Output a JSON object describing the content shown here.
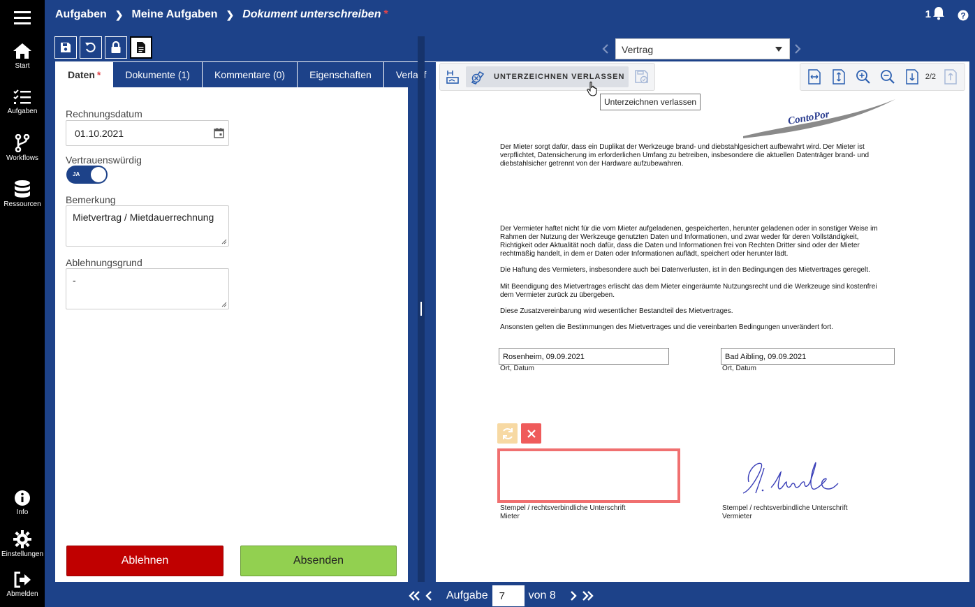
{
  "nav": {
    "home": "Start",
    "tasks": "Aufgaben",
    "workflows": "Workflows",
    "resources": "Ressourcen",
    "info": "Info",
    "settings": "Einstellungen",
    "logout": "Abmelden"
  },
  "header": {
    "crumb1": "Aufgaben",
    "crumb2": "Meine Aufgaben",
    "crumb3": "Dokument unterschreiben",
    "required_mark": "*",
    "notification_count": "1"
  },
  "tabs": {
    "data": "Daten",
    "data_required": "*",
    "documents": "Dokumente (1)",
    "comments": "Kommentare (0)",
    "properties": "Eigenschaften",
    "history": "Verlauf"
  },
  "form": {
    "invoice_date_label": "Rechnungsdatum",
    "invoice_date_value": "01.10.2021",
    "trustworthy_label": "Vertrauenswürdig",
    "trustworthy_toggle": "JA",
    "remark_label": "Bemerkung",
    "remark_value": "Mietvertrag / Mietdauerrechnung",
    "rejection_label": "Ablehnungsgrund",
    "rejection_value": "-",
    "reject_button": "Ablehnen",
    "send_button": "Absenden"
  },
  "viewer": {
    "document_select": "Vertrag",
    "leave_signing": "UNTERZEICHNEN VERLASSEN",
    "tooltip": "Unterzeichnen verlassen",
    "page_indicator": "2/2",
    "logo_text": "ContoPor",
    "para1": "Der Mieter sorgt dafür, dass ein Duplikat der Werkzeuge brand- und diebstahlgesichert aufbewahrt wird. Der Mieter ist verpflichtet, Datensicherung im erforderlichen Umfang zu betreiben, insbesondere die aktuellen Datenträger brand- und diebstahlsicher getrennt von der Hardware aufzubewahren.",
    "para2": "Der Vermieter haftet nicht für die vom Mieter aufgeladenen, gespeicherten, herunter geladenen oder in sonstiger Weise im Rahmen der Nutzung der Werkzeuge genutzten Daten und Informationen, und zwar weder für deren Vollständigkeit, Richtigkeit oder Aktualität noch dafür, dass die Daten und Informationen frei von Rechten Dritter sind oder der Mieter rechtmäßig handelt, in dem er Daten oder Informationen auflädt, speichert oder herunter lädt.",
    "para3": "Die Haftung des Vermieters, insbesondere auch bei Datenverlusten, ist in den Bedingungen des Mietvertrages geregelt.",
    "para4": "Mit Beendigung des Mietvertrages erlischt das dem Mieter eingeräumte Nutzungsrecht und die Werkzeuge sind kostenfrei dem Vermieter zurück zu übergeben.",
    "para5": "Diese Zusatzvereinbarung wird wesentlicher Bestandteil des Mietvertrages.",
    "para6": "Ansonsten gelten die Bestimmungen des Mietvertrages und die vereinbarten Bedingungen unverändert fort.",
    "place_date_left": "Rosenheim, 09.09.2021",
    "place_date_right": "Bad Aibling, 09.09.2021",
    "place_date_caption": "Ort, Datum",
    "stamp_caption": "Stempel / rechtsverbindliche Unterschrift",
    "tenant": "Mieter",
    "landlord": "Vermieter"
  },
  "pager": {
    "label": "Aufgabe",
    "current": "7",
    "of_label": "von 8"
  },
  "colors": {
    "brand_blue": "#1d4289",
    "reject_red": "#c00000",
    "send_green": "#92d050",
    "signature_frame": "#f07070"
  }
}
